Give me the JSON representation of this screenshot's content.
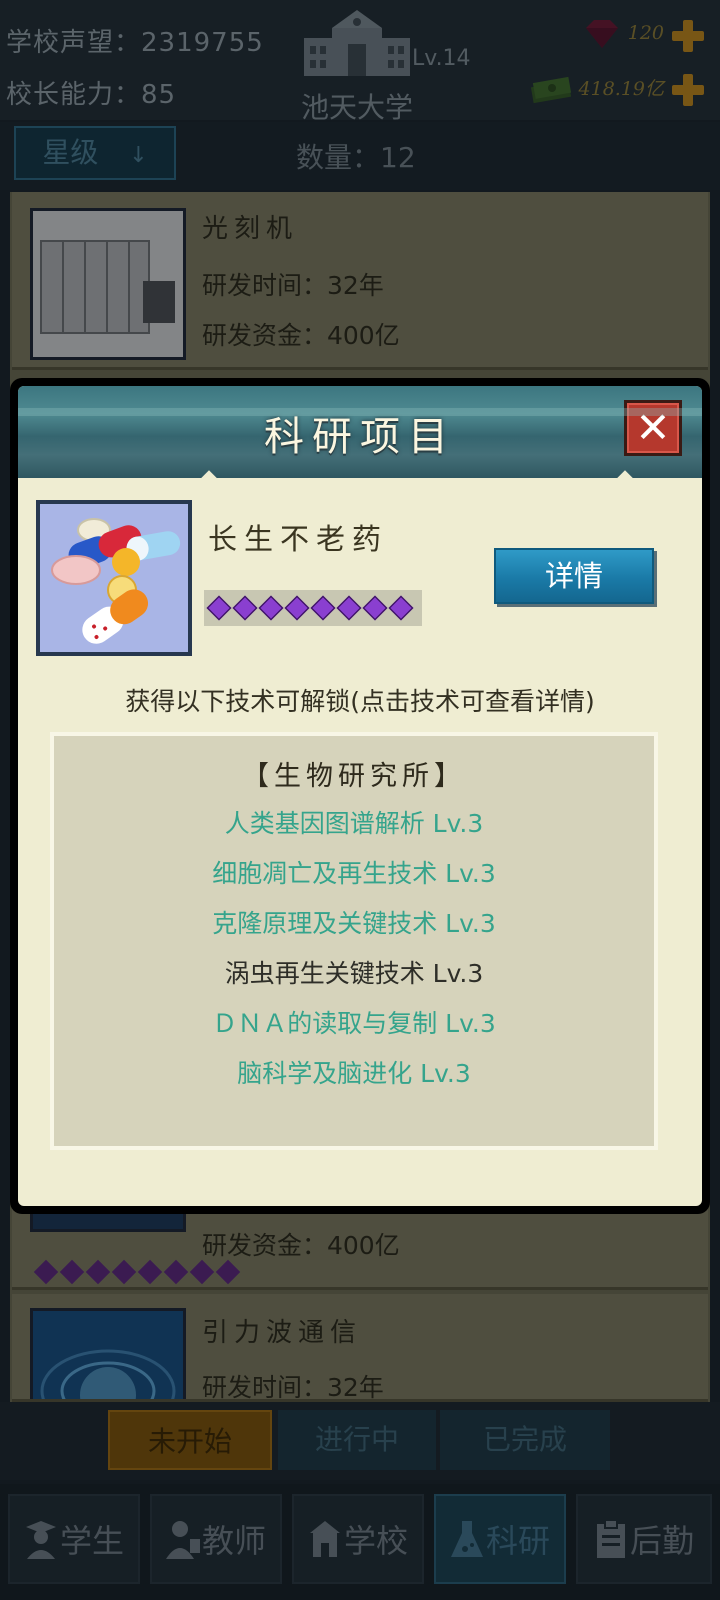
{
  "header": {
    "reputation_label": "学校声望：2319755",
    "principal_label": "校长能力：85",
    "school_level": "Lv.14",
    "school_name": "池天大学",
    "gems": "120",
    "money": "418.19亿"
  },
  "filter": {
    "sort_label": "星级",
    "sort_arrow": "↓",
    "count_label": "数量：12"
  },
  "list": {
    "card1": {
      "title": "光刻机",
      "time": "研发时间：32年",
      "fund": "研发资金：400亿"
    },
    "card2": {
      "fund": "研发资金：400亿",
      "stars": 8
    },
    "card3": {
      "title": "引力波通信",
      "time": "研发时间：32年"
    }
  },
  "status_tabs": [
    "未开始",
    "进行中",
    "已完成"
  ],
  "bottom_nav": [
    {
      "label": "学生",
      "icon": "student-icon"
    },
    {
      "label": "教师",
      "icon": "teacher-icon"
    },
    {
      "label": "学校",
      "icon": "school-icon"
    },
    {
      "label": "科研",
      "icon": "flask-icon"
    },
    {
      "label": "后勤",
      "icon": "clipboard-icon"
    }
  ],
  "dialog": {
    "title": "科研项目",
    "close_glyph": "✕",
    "project_name": "长生不老药",
    "project_stars": 8,
    "detail_button": "详情",
    "unlock_hint": "获得以下技术可解锁(点击技术可查看详情)",
    "category": "【生物研究所】",
    "techs": [
      {
        "label": "人类基因图谱解析 Lv.3",
        "state": "highlight"
      },
      {
        "label": "细胞凋亡及再生技术 Lv.3",
        "state": "highlight"
      },
      {
        "label": "克隆原理及关键技术 Lv.3",
        "state": "highlight"
      },
      {
        "label": "涡虫再生关键技术 Lv.3",
        "state": "plain"
      },
      {
        "label": "ＤＮＡ的读取与复制 Lv.3",
        "state": "highlight"
      },
      {
        "label": "脑科学及脑进化 Lv.3",
        "state": "highlight"
      }
    ]
  },
  "colors": {
    "highlight_text": "#35a48c",
    "plain_text": "#2e2e28",
    "accent_gold": "#b98421",
    "detail_button": "#1a7aa7",
    "close_button": "#b5382d"
  }
}
